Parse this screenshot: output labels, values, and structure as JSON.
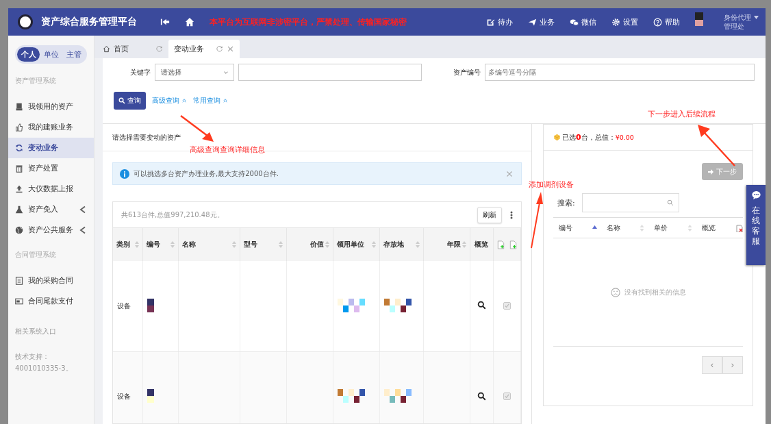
{
  "header": {
    "title": "资产综合服务管理平台",
    "notice": "本平台为互联网非涉密平台，严禁处理、传输国家秘密",
    "nav": [
      {
        "label": "待办",
        "kind": "edit"
      },
      {
        "label": "业务",
        "kind": "send"
      },
      {
        "label": "微信",
        "kind": "chat"
      },
      {
        "label": "设置",
        "kind": "gear"
      },
      {
        "label": "帮助",
        "kind": "help"
      }
    ],
    "user": {
      "role": "身份代理",
      "dept": "管理处"
    }
  },
  "sidebar": {
    "scope_tabs": [
      {
        "label": "个人",
        "selected": true
      },
      {
        "label": "单位",
        "selected": false
      },
      {
        "label": "主管",
        "selected": false
      }
    ],
    "sections": [
      {
        "title": "资产管理系统",
        "items": [
          {
            "label": "我领用的资产",
            "selected": false,
            "expandable": false
          },
          {
            "label": "我的建账业务",
            "selected": false,
            "expandable": false
          },
          {
            "label": "变动业务",
            "selected": true,
            "expandable": false
          },
          {
            "label": "资产处置",
            "selected": false,
            "expandable": false
          },
          {
            "label": "大仪数据上报",
            "selected": false,
            "expandable": false
          },
          {
            "label": "资产免入",
            "selected": false,
            "expandable": true
          },
          {
            "label": "资产公共服务",
            "selected": false,
            "expandable": true
          }
        ]
      },
      {
        "title": "合同管理系统",
        "items": [
          {
            "label": "我的采购合同",
            "selected": false,
            "expandable": false
          },
          {
            "label": "合同尾款支付",
            "selected": false,
            "expandable": false
          }
        ]
      }
    ],
    "links_title": "相关系统入口",
    "support": "技术支持：4001010335-3。"
  },
  "page_tabs": [
    {
      "label": "首页",
      "home": true,
      "selected": false,
      "closable": false
    },
    {
      "label": "变动业务",
      "home": false,
      "selected": true,
      "closable": true
    }
  ],
  "search": {
    "keyword_label": "关键字",
    "keyword_select": "请选择",
    "asset_no_label": "资产编号",
    "asset_no_placeholder": "多编号逗号分隔",
    "query_button": "查询",
    "links": [
      "高级查询",
      "常用查询"
    ]
  },
  "asset_panel": {
    "title": "请选择需要变动的资产",
    "alert": "可以挑选多台资产办理业务,最大支持2000台件.",
    "summary": "共613台件,总值997,210.48元。",
    "refresh": "刷新",
    "columns": [
      {
        "label": "类别",
        "sortable": true
      },
      {
        "label": "编号",
        "sortable": true
      },
      {
        "label": "名称",
        "sortable": true
      },
      {
        "label": "型号",
        "sortable": true
      },
      {
        "label": "价值",
        "sortable": true
      },
      {
        "label": "领用单位",
        "sortable": true
      },
      {
        "label": "存放地",
        "sortable": true
      },
      {
        "label": "年限",
        "sortable": true
      },
      {
        "label": "概览",
        "sortable": false
      }
    ],
    "rows": [
      {
        "category": "设备",
        "checked": true,
        "disabled": true
      },
      {
        "category": "设备",
        "checked": true,
        "disabled": true
      }
    ]
  },
  "selected_panel": {
    "selected_prefix": "已选",
    "count": "0",
    "selected_mid": "台，总值：",
    "total": "¥0.00",
    "next_button": {
      "label": "下一步",
      "disabled": true
    },
    "search_label": "搜索:",
    "columns": [
      {
        "label": "编号",
        "sortable": true,
        "sorted": true
      },
      {
        "label": "名称",
        "sortable": true,
        "sorted": false
      },
      {
        "label": "单价",
        "sortable": true,
        "sorted": false
      },
      {
        "label": "概览",
        "sortable": false,
        "sorted": false
      }
    ],
    "empty": "没有找到相关的信息",
    "pager": [
      "‹",
      "›"
    ]
  },
  "chat_widget": "在线客服",
  "annotations": [
    {
      "text": "高级查询查询详细信息"
    },
    {
      "text": "添加调剂设备"
    },
    {
      "text": "下一步进入后续流程"
    }
  ]
}
